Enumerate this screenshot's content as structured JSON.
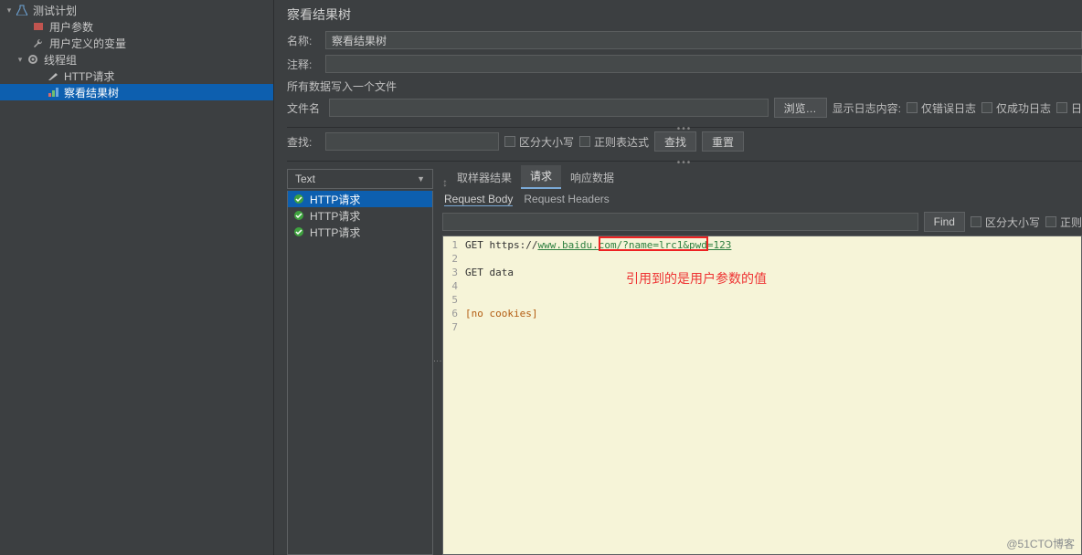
{
  "tree": {
    "plan": "测试计划",
    "user_params": "用户参数",
    "user_vars": "用户定义的变量",
    "thread_group": "线程组",
    "http_req": "HTTP请求",
    "view_tree": "察看结果树"
  },
  "panel": {
    "title": "察看结果树",
    "name_label": "名称:",
    "name_value": "察看结果树",
    "comment_label": "注释:",
    "write_all": "所有数据写入一个文件",
    "file_label": "文件名",
    "browse": "浏览…",
    "show_log_label": "显示日志内容:",
    "only_error": "仅错误日志",
    "only_success": "仅成功日志",
    "log_cfg_short": "日"
  },
  "search": {
    "label": "查找:",
    "case": "区分大小写",
    "regex": "正则表达式",
    "find_btn": "查找",
    "reset_btn": "重置"
  },
  "results": {
    "combo": "Text",
    "items": [
      "HTTP请求",
      "HTTP请求",
      "HTTP请求"
    ]
  },
  "tabs": {
    "first": [
      "取样器结果",
      "请求",
      "响应数据"
    ],
    "active1": 1,
    "second": [
      "Request Body",
      "Request Headers"
    ],
    "active2": 0
  },
  "find2": {
    "btn": "Find",
    "case": "区分大小写",
    "regex_short": "正则"
  },
  "editor": {
    "lines": {
      "l1_a": "GET ",
      "l1_b": "https://",
      "l1_c": "www.baidu.com/",
      "l1_d": "?name=lrc1&pwd=123",
      "l3": "GET data",
      "l6_a": "[",
      "l6_b": "no cookies",
      "l6_c": "]"
    }
  },
  "annotation": "引用到的是用户参数的值",
  "watermark": "@51CTO博客"
}
